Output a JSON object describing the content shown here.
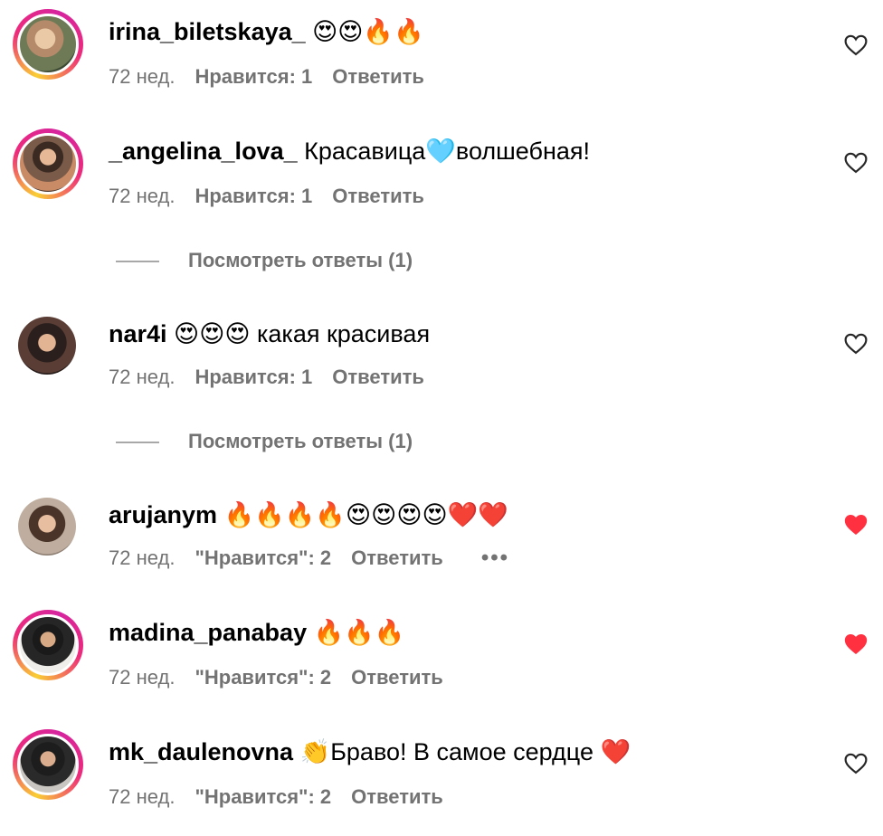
{
  "comments": [
    {
      "username": "irina_biletskaya_",
      "text": " 😍😍🔥🔥",
      "time": "72 нед.",
      "likes": "Нравится: 1",
      "reply": "Ответить",
      "liked": false,
      "has_story_ring": true
    },
    {
      "username": "_angelina_lova_",
      "text": " Красавица🩵волшебная!",
      "time": "72 нед.",
      "likes": "Нравится: 1",
      "reply": "Ответить",
      "liked": false,
      "has_story_ring": true,
      "view_replies": "Посмотреть ответы (1)"
    },
    {
      "username": "nar4i",
      "text": " 😍😍😍 какая красивая",
      "time": "72 нед.",
      "likes": "Нравится: 1",
      "reply": "Ответить",
      "liked": false,
      "has_story_ring": false,
      "view_replies": "Посмотреть ответы (1)"
    },
    {
      "username": "arujanym",
      "text": " 🔥🔥🔥🔥😍😍😍😍❤️❤️",
      "time": "72 нед.",
      "likes": "\"Нравится\": 2",
      "reply": "Ответить",
      "more": "•••",
      "liked": true,
      "has_story_ring": false
    },
    {
      "username": "madina_panabay",
      "text": " 🔥🔥🔥",
      "time": "72 нед.",
      "likes": "\"Нравится\": 2",
      "reply": "Ответить",
      "liked": true,
      "has_story_ring": true
    },
    {
      "username": "mk_daulenovna",
      "text": " 👏Браво! В самое сердце ❤️",
      "time": "72 нед.",
      "likes": "\"Нравится\": 2",
      "reply": "Ответить",
      "liked": false,
      "has_story_ring": true
    }
  ],
  "colors": {
    "text_primary": "#000000",
    "text_secondary": "#737373",
    "heart_liked": "#ff3040",
    "divider": "#a8a8a8"
  },
  "icons": {
    "like": "heart-outline-icon",
    "liked": "heart-filled-icon",
    "more": "more-dots-icon"
  }
}
